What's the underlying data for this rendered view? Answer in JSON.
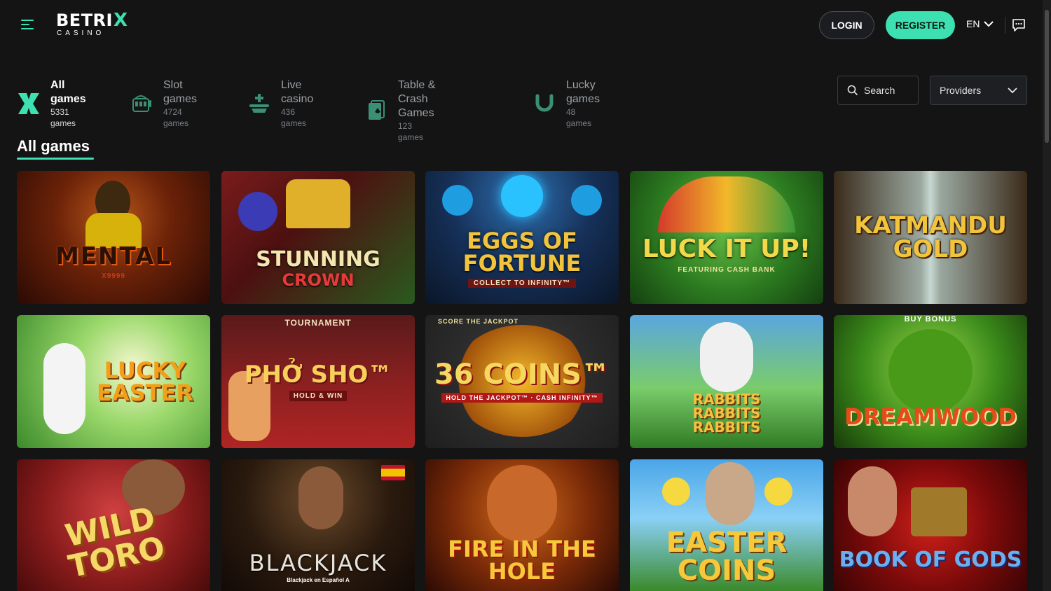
{
  "header": {
    "logo_main": "BETRI",
    "logo_x": "X",
    "logo_sub": "CASINO",
    "login_label": "LOGIN",
    "register_label": "REGISTER",
    "language": "EN"
  },
  "categories": [
    {
      "name": "All games",
      "count": "5331 games",
      "icon": "all-games-icon",
      "active": true
    },
    {
      "name": "Slot games",
      "count": "4724 games",
      "icon": "slot-machine-icon",
      "active": false
    },
    {
      "name": "Live casino",
      "count": "436 games",
      "icon": "live-casino-icon",
      "active": false
    },
    {
      "name": "Table & Crash Games",
      "count": "123 games",
      "icon": "cards-icon",
      "active": false
    },
    {
      "name": "Lucky games",
      "count": "48 games",
      "icon": "horseshoe-icon",
      "active": false
    }
  ],
  "search": {
    "label": "Search"
  },
  "providers": {
    "label": "Providers"
  },
  "section_title": "All games",
  "games": [
    {
      "title": "MENTAL",
      "sub": "X9999",
      "top": ""
    },
    {
      "title": "STUNNING",
      "sub": "CROWN",
      "top": ""
    },
    {
      "title": "EGGS OF FORTUNE",
      "sub": "COLLECT TO INFINITY™",
      "top": ""
    },
    {
      "title": "LUCK IT UP!",
      "sub": "FEATURING CASH BANK",
      "top": ""
    },
    {
      "title": "KATMANDU GOLD",
      "sub": "",
      "top": ""
    },
    {
      "title": "LUCKY EASTER",
      "sub": "",
      "top": ""
    },
    {
      "title": "PHỞ SHO™",
      "sub": "HOLD & WIN",
      "top": "TOURNAMENT"
    },
    {
      "title": "36 COINS™",
      "sub": "HOLD THE JACKPOT™ · CASH INFINITY™",
      "top": "SCORE THE JACKPOT"
    },
    {
      "title": "RABBITS RABBITS RABBITS",
      "sub": "",
      "top": ""
    },
    {
      "title": "DREAMWOOD",
      "sub": "",
      "top": "BUY BONUS"
    },
    {
      "title": "WILD TORO",
      "sub": "",
      "top": ""
    },
    {
      "title": "BLACKJACK",
      "sub": "Blackjack en Español A",
      "top": ""
    },
    {
      "title": "FIRE IN THE HOLE",
      "sub": "",
      "top": ""
    },
    {
      "title": "EASTER COINS",
      "sub": "",
      "top": ""
    },
    {
      "title": "BOOK OF GODS",
      "sub": "",
      "top": ""
    }
  ],
  "colors": {
    "accent": "#3de0b0",
    "background": "#141414"
  }
}
